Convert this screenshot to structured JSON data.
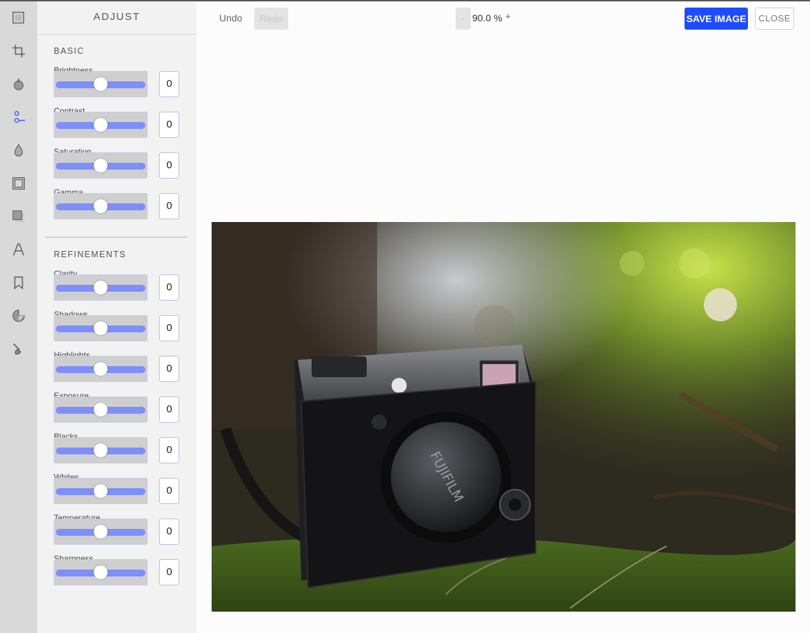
{
  "panel": {
    "title": "ADJUST",
    "sections": [
      {
        "title": "BASIC",
        "controls": [
          {
            "label": "Brightness",
            "value": "0"
          },
          {
            "label": "Contrast",
            "value": "0"
          },
          {
            "label": "Saturation",
            "value": "0"
          },
          {
            "label": "Gamma",
            "value": "0"
          }
        ]
      },
      {
        "title": "REFINEMENTS",
        "controls": [
          {
            "label": "Clarity",
            "value": "0"
          },
          {
            "label": "Shadows",
            "value": "0"
          },
          {
            "label": "Highlights",
            "value": "0"
          },
          {
            "label": "Exposure",
            "value": "0"
          },
          {
            "label": "Blacks",
            "value": "0"
          },
          {
            "label": "Whites",
            "value": "0"
          },
          {
            "label": "Temperature",
            "value": "0"
          },
          {
            "label": "Sharpness",
            "value": "0"
          }
        ]
      }
    ]
  },
  "rail": {
    "icons": [
      "image-icon",
      "crop-icon",
      "timer-icon",
      "adjust-sliders-icon",
      "drop-icon",
      "frame-icon",
      "shape-icon",
      "text-icon",
      "bookmark-icon",
      "sticker-icon",
      "brush-icon"
    ],
    "active": "adjust-sliders-icon"
  },
  "toolbar": {
    "undo_label": "Undo",
    "redo_label": "Redo",
    "zoom_minus": "-",
    "zoom_value": "90.0 %",
    "zoom_plus": "+",
    "save_label": "SAVE IMAGE",
    "close_label": "CLOSE"
  },
  "colors": {
    "accent": "#1e4bff",
    "slider_track": "#7e8ffa",
    "active_icon": "#3b5bff"
  },
  "photo": {
    "lens_text": "FUJIFILM"
  }
}
